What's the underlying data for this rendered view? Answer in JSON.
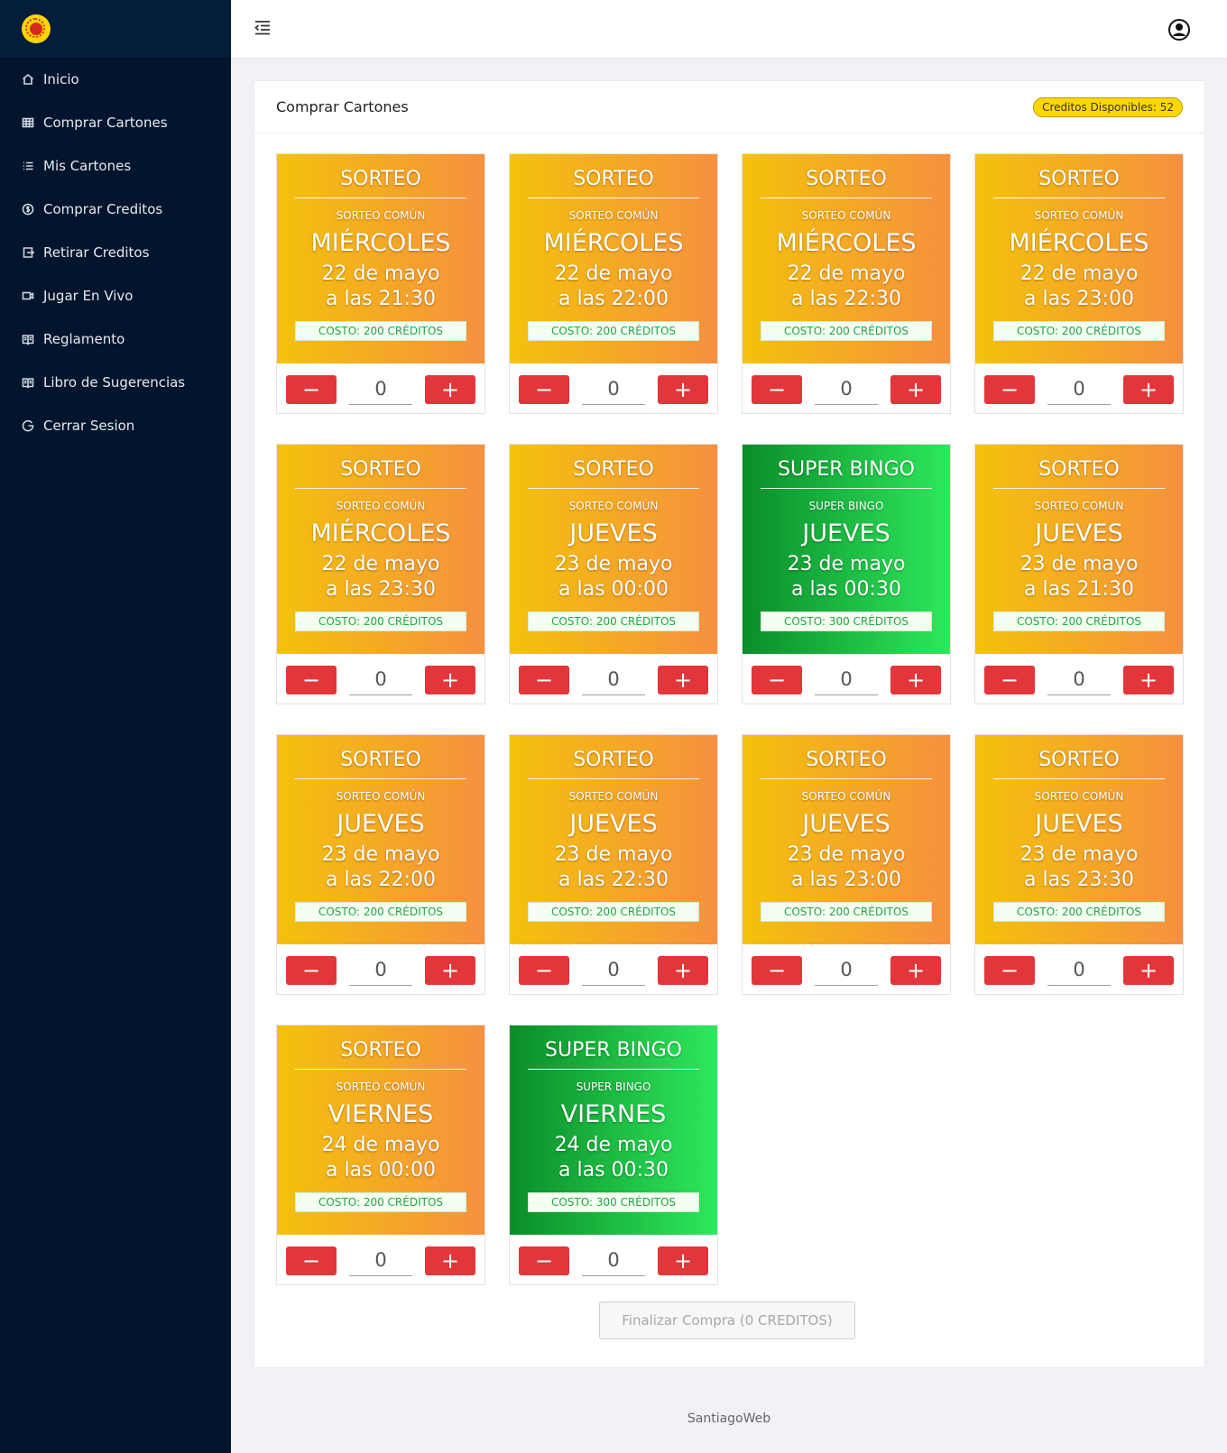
{
  "sidebar": {
    "items": [
      {
        "label": "Inicio",
        "icon": "home-icon"
      },
      {
        "label": "Comprar Cartones",
        "icon": "grid-icon"
      },
      {
        "label": "Mis Cartones",
        "icon": "list-icon"
      },
      {
        "label": "Comprar Creditos",
        "icon": "coin-icon"
      },
      {
        "label": "Retirar Creditos",
        "icon": "withdraw-icon"
      },
      {
        "label": "Jugar En Vivo",
        "icon": "video-icon"
      },
      {
        "label": "Reglamento",
        "icon": "book-icon"
      },
      {
        "label": "Libro de Sugerencias",
        "icon": "book-icon"
      },
      {
        "label": "Cerrar Sesion",
        "icon": "logout-icon"
      }
    ]
  },
  "panel": {
    "title": "Comprar Cartones",
    "credits": "Creditos Disponibles: 52"
  },
  "tickets": [
    {
      "variant": "orange",
      "head": "SORTEO",
      "sub": "SORTEO COMÚN",
      "day": "MIÉRCOLES",
      "date": "22 de mayo",
      "time": "a las 21:30",
      "cost": "COSTO: 200 CRÉDITOS",
      "qty": "0"
    },
    {
      "variant": "orange",
      "head": "SORTEO",
      "sub": "SORTEO COMÚN",
      "day": "MIÉRCOLES",
      "date": "22 de mayo",
      "time": "a las 22:00",
      "cost": "COSTO: 200 CRÉDITOS",
      "qty": "0"
    },
    {
      "variant": "orange",
      "head": "SORTEO",
      "sub": "SORTEO COMÚN",
      "day": "MIÉRCOLES",
      "date": "22 de mayo",
      "time": "a las 22:30",
      "cost": "COSTO: 200 CRÉDITOS",
      "qty": "0"
    },
    {
      "variant": "orange",
      "head": "SORTEO",
      "sub": "SORTEO COMÚN",
      "day": "MIÉRCOLES",
      "date": "22 de mayo",
      "time": "a las 23:00",
      "cost": "COSTO: 200 CRÉDITOS",
      "qty": "0"
    },
    {
      "variant": "orange",
      "head": "SORTEO",
      "sub": "SORTEO COMÚN",
      "day": "MIÉRCOLES",
      "date": "22 de mayo",
      "time": "a las 23:30",
      "cost": "COSTO: 200 CRÉDITOS",
      "qty": "0"
    },
    {
      "variant": "orange",
      "head": "SORTEO",
      "sub": "SORTEO COMÚN",
      "day": "JUEVES",
      "date": "23 de mayo",
      "time": "a las 00:00",
      "cost": "COSTO: 200 CRÉDITOS",
      "qty": "0"
    },
    {
      "variant": "green",
      "head": "SUPER BINGO",
      "sub": "SUPER BINGO",
      "day": "JUEVES",
      "date": "23 de mayo",
      "time": "a las 00:30",
      "cost": "COSTO: 300 CRÉDITOS",
      "qty": "0"
    },
    {
      "variant": "orange",
      "head": "SORTEO",
      "sub": "SORTEO COMÚN",
      "day": "JUEVES",
      "date": "23 de mayo",
      "time": "a las 21:30",
      "cost": "COSTO: 200 CRÉDITOS",
      "qty": "0"
    },
    {
      "variant": "orange",
      "head": "SORTEO",
      "sub": "SORTEO COMÚN",
      "day": "JUEVES",
      "date": "23 de mayo",
      "time": "a las 22:00",
      "cost": "COSTO: 200 CRÉDITOS",
      "qty": "0"
    },
    {
      "variant": "orange",
      "head": "SORTEO",
      "sub": "SORTEO COMÚN",
      "day": "JUEVES",
      "date": "23 de mayo",
      "time": "a las 22:30",
      "cost": "COSTO: 200 CRÉDITOS",
      "qty": "0"
    },
    {
      "variant": "orange",
      "head": "SORTEO",
      "sub": "SORTEO COMÚN",
      "day": "JUEVES",
      "date": "23 de mayo",
      "time": "a las 23:00",
      "cost": "COSTO: 200 CRÉDITOS",
      "qty": "0"
    },
    {
      "variant": "orange",
      "head": "SORTEO",
      "sub": "SORTEO COMÚN",
      "day": "JUEVES",
      "date": "23 de mayo",
      "time": "a las 23:30",
      "cost": "COSTO: 200 CRÉDITOS",
      "qty": "0"
    },
    {
      "variant": "orange",
      "head": "SORTEO",
      "sub": "SORTEO COMÚN",
      "day": "VIERNES",
      "date": "24 de mayo",
      "time": "a las 00:00",
      "cost": "COSTO: 200 CRÉDITOS",
      "qty": "0"
    },
    {
      "variant": "green",
      "head": "SUPER BINGO",
      "sub": "SUPER BINGO",
      "day": "VIERNES",
      "date": "24 de mayo",
      "time": "a las 00:30",
      "cost": "COSTO: 300 CRÉDITOS",
      "qty": "0"
    }
  ],
  "controls": {
    "minus": "−",
    "plus": "+"
  },
  "finalize_label": "Finalizar Compra (0 CREDITOS)",
  "footer": "SantiagoWeb",
  "colors": {
    "sidebar": "#02152c",
    "orange_start": "#f3c20b",
    "orange_end": "#f6903f",
    "green_start": "#0b8d29",
    "green_end": "#2ee85c",
    "button_red": "#e2363a",
    "badge": "#ffd700"
  }
}
